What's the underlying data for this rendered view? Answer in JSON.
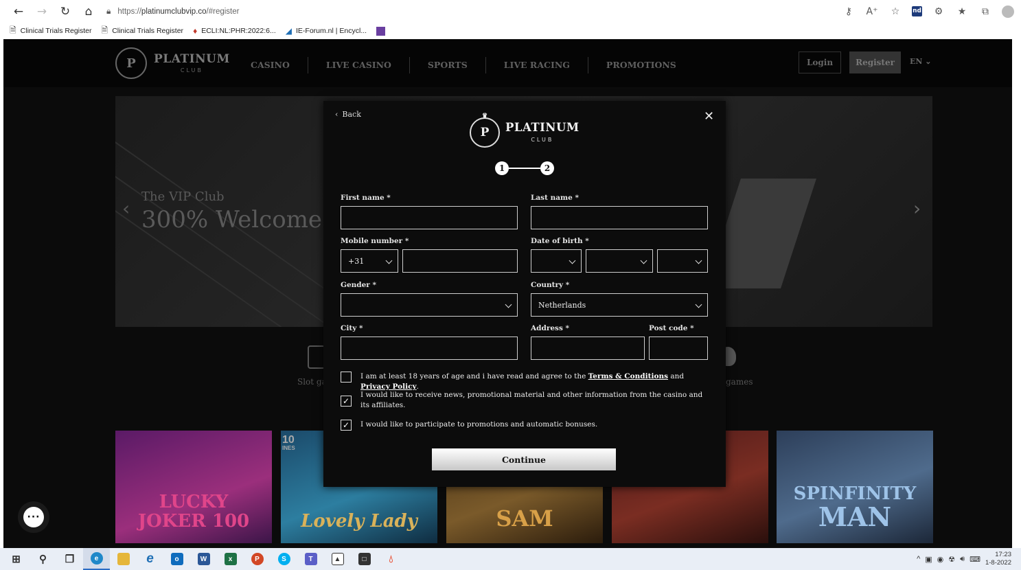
{
  "browser": {
    "url_scheme": "https://",
    "url_host": "platinumclubvip.co",
    "url_path": "/#register",
    "bookmarks": [
      {
        "label": "Clinical Trials Register"
      },
      {
        "label": "Clinical Trials Register"
      },
      {
        "label": "ECLI:NL:PHR:2022:6..."
      },
      {
        "label": "IE-Forum.nl | Encycl..."
      }
    ],
    "toolbar_icons": [
      "key-icon",
      "read-aloud-icon",
      "favorite-add-icon",
      "nd-extension-icon",
      "extensions-icon",
      "favorites-icon",
      "collections-icon",
      "profile-icon"
    ]
  },
  "site": {
    "logo_text": "PLATINUM",
    "logo_sub": "CLUB",
    "nav": [
      "CASINO",
      "LIVE CASINO",
      "SPORTS",
      "LIVE RACING",
      "PROMOTIONS"
    ],
    "login": "Login",
    "register": "Register",
    "lang": "EN",
    "banner_small": "The VIP Club",
    "banner_big": "300% Welcome",
    "cat_slot": "Slot ga",
    "cat_games": "games",
    "tiles": [
      {
        "title": "LUCKY JOKER 100",
        "title_line1": "LUCKY",
        "title_line2": "JOKER 100",
        "color": "#e0458a"
      },
      {
        "title": "Lovely Lady",
        "badge": "10",
        "badge_sub": "INES",
        "color": "#d9b25a"
      },
      {
        "title": "SAM",
        "color": "#d8a048"
      },
      {
        "title": "",
        "color": "#c77d3a"
      },
      {
        "title": "SPINFINITY MAN",
        "title_line1": "SPINFINITY",
        "title_line2": "MAN",
        "color": "#9ec3e8"
      }
    ]
  },
  "modal": {
    "back": "Back",
    "logo_text": "PLATINUM",
    "logo_sub": "CLUB",
    "steps": [
      "1",
      "2"
    ],
    "first_name_label": "First name *",
    "last_name_label": "Last name *",
    "mobile_label": "Mobile number *",
    "dial_code": "+31",
    "dob_label": "Date of birth *",
    "gender_label": "Gender *",
    "country_label": "Country *",
    "country_value": "Netherlands",
    "city_label": "City *",
    "address_label": "Address *",
    "postcode_label": "Post code *",
    "consent_age_pre": "I am at least 18 years of age and i have read and agree to the ",
    "terms_link": "Terms & Conditions",
    "consent_and": " and ",
    "privacy_link": "Privacy Policy",
    "consent_end": ".",
    "consent_age_checked": false,
    "consent_news": "I would like to receive news, promotional material and other information from the casino and its affiliates.",
    "consent_news_checked": true,
    "consent_promo": "I would like to participate to promotions and automatic bonuses.",
    "consent_promo_checked": true,
    "continue": "Continue"
  },
  "taskbar": {
    "time": "17:23",
    "date": "1-8-2022"
  }
}
